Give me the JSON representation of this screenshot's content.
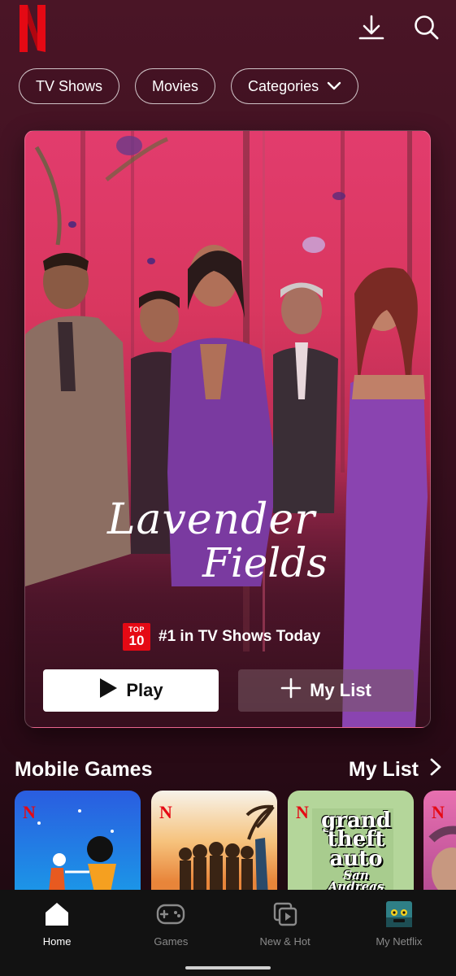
{
  "app": {
    "logo_letter": "N",
    "brand_color": "#e50914"
  },
  "topbar": {
    "download_icon": "download-icon",
    "search_icon": "search-icon"
  },
  "chips": [
    {
      "label": "TV Shows"
    },
    {
      "label": "Movies"
    },
    {
      "label": "Categories",
      "icon": "chevron-down-icon"
    }
  ],
  "hero": {
    "title_line1": "Lavender",
    "title_line2": "Fields",
    "badge_top": "TOP",
    "badge_num": "10",
    "rank_text": "#1 in TV Shows Today",
    "play_label": "Play",
    "mylist_label": "My List"
  },
  "row": {
    "title": "Mobile Games",
    "link_label": "My List"
  },
  "tiles": [
    {
      "name": "game-tile-1",
      "logo": "N"
    },
    {
      "name": "game-tile-2",
      "logo": "N"
    },
    {
      "name": "game-tile-3",
      "logo": "N",
      "art_text": [
        "grand",
        "theft",
        "auto",
        "San Andreas"
      ]
    },
    {
      "name": "game-tile-4",
      "logo": "N"
    }
  ],
  "nav": [
    {
      "label": "Home",
      "icon": "home-icon",
      "active": true
    },
    {
      "label": "Games",
      "icon": "gamepad-icon",
      "active": false
    },
    {
      "label": "New & Hot",
      "icon": "new-hot-icon",
      "active": false
    },
    {
      "label": "My Netflix",
      "icon": "profile-avatar-icon",
      "active": false
    }
  ]
}
